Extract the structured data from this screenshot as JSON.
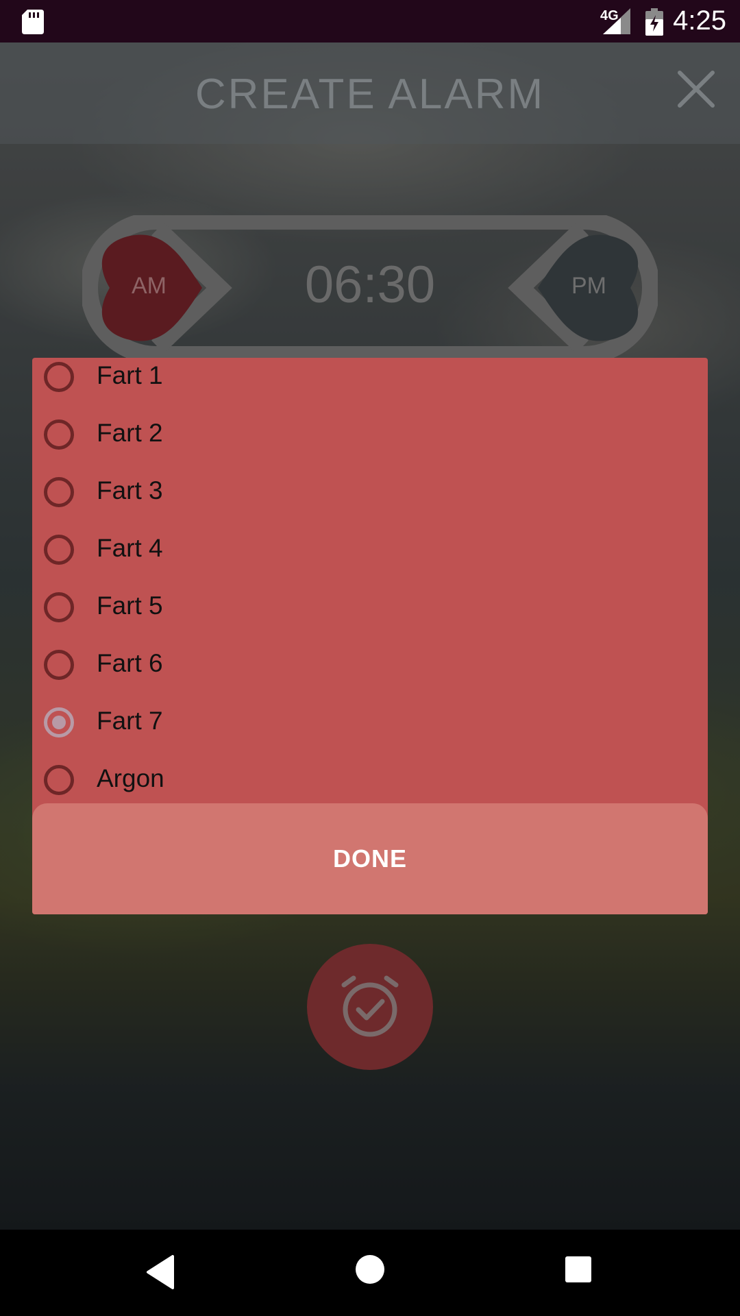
{
  "status_bar": {
    "network": "4G",
    "time": "4:25"
  },
  "header": {
    "title": "CREATE ALARM"
  },
  "time_picker": {
    "time": "06:30",
    "am_label": "AM",
    "pm_label": "PM",
    "selected_period": "AM"
  },
  "sound_dialog": {
    "items": [
      {
        "label": "Fart 1",
        "selected": false
      },
      {
        "label": "Fart 2",
        "selected": false
      },
      {
        "label": "Fart 3",
        "selected": false
      },
      {
        "label": "Fart 4",
        "selected": false
      },
      {
        "label": "Fart 5",
        "selected": false
      },
      {
        "label": "Fart 6",
        "selected": false
      },
      {
        "label": "Fart 7",
        "selected": true
      },
      {
        "label": "Argon",
        "selected": false
      }
    ],
    "done_label": "DONE"
  },
  "colors": {
    "status_bar": "#22071a",
    "dialog": "#bf5252",
    "done_area": "#d17670",
    "radio_unchecked": "#6e2627",
    "radio_checked": "#b89aa6",
    "fab": "#6e2a2c"
  },
  "icons": {
    "status_left": "sd-card-icon",
    "signal": "signal-icon",
    "battery": "battery-charging-icon",
    "close": "close-icon",
    "fab": "alarm-check-icon",
    "nav_back": "back-icon",
    "nav_home": "home-icon",
    "nav_recents": "recents-icon"
  }
}
